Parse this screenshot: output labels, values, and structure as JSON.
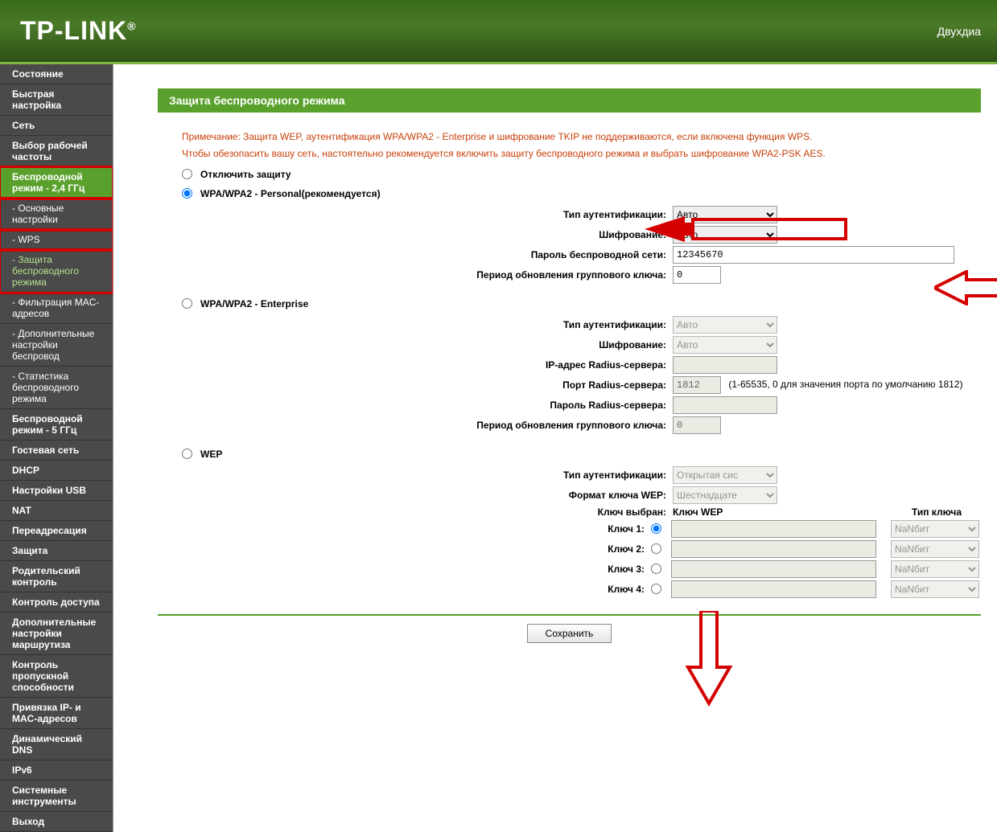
{
  "header": {
    "logo": "TP-LINK",
    "logo_reg": "®",
    "right": "Двухдиа"
  },
  "sidebar": {
    "items": [
      {
        "label": "Состояние",
        "sub": false
      },
      {
        "label": "Быстрая настройка",
        "sub": false
      },
      {
        "label": "Сеть",
        "sub": false
      },
      {
        "label": "Выбор рабочей частоты",
        "sub": false
      },
      {
        "label": "Беспроводной режим - 2,4 ГГц",
        "sub": false,
        "active": true,
        "hl": true
      },
      {
        "label": "- Основные настройки",
        "sub": true,
        "hl": true
      },
      {
        "label": "- WPS",
        "sub": true,
        "hl": true
      },
      {
        "label": "- Защита беспроводного режима",
        "sub": true,
        "current": true,
        "hl": true
      },
      {
        "label": "- Фильтрация MAC-адресов",
        "sub": true
      },
      {
        "label": "- Дополнительные настройки беспровод",
        "sub": true
      },
      {
        "label": "- Статистика беспроводного режима",
        "sub": true
      },
      {
        "label": "Беспроводной режим - 5 ГГц",
        "sub": false
      },
      {
        "label": "Гостевая сеть",
        "sub": false
      },
      {
        "label": "DHCP",
        "sub": false
      },
      {
        "label": "Настройки USB",
        "sub": false
      },
      {
        "label": "NAT",
        "sub": false
      },
      {
        "label": "Переадресация",
        "sub": false
      },
      {
        "label": "Защита",
        "sub": false
      },
      {
        "label": "Родительский контроль",
        "sub": false
      },
      {
        "label": "Контроль доступа",
        "sub": false
      },
      {
        "label": "Дополнительные настройки маршрутиза",
        "sub": false
      },
      {
        "label": "Контроль пропускной способности",
        "sub": false
      },
      {
        "label": "Привязка IP- и MAC-адресов",
        "sub": false
      },
      {
        "label": "Динамический DNS",
        "sub": false
      },
      {
        "label": "IPv6",
        "sub": false
      },
      {
        "label": "Системные инструменты",
        "sub": false
      },
      {
        "label": "Выход",
        "sub": false
      }
    ]
  },
  "page": {
    "title": "Защита беспроводного режима",
    "note1": "Примечание: Защита WEP, аутентификация WPA/WPA2 - Enterprise и шифрование TKIP не поддерживаются, если включена функция WPS.",
    "note2": "Чтобы обезопасить вашу сеть, настоятельно рекомендуется включить защиту беспроводного режима и выбрать шифрование WPA2-PSK AES."
  },
  "opt_disable": {
    "label": "Отключить защиту"
  },
  "personal": {
    "label": "WPA/WPA2 - Personal(рекомендуется)",
    "auth_label": "Тип аутентификации:",
    "auth_value": "Авто",
    "enc_label": "Шифрование:",
    "enc_value": "Авто",
    "pwd_label": "Пароль беспроводной сети:",
    "pwd_value": "12345670",
    "period_label": "Период обновления группового ключа:",
    "period_value": "0"
  },
  "enterprise": {
    "label": "WPA/WPA2 - Enterprise",
    "auth_label": "Тип аутентификации:",
    "auth_value": "Авто",
    "enc_label": "Шифрование:",
    "enc_value": "Авто",
    "radius_ip_label": "IP-адрес Radius-сервера:",
    "radius_ip_value": "",
    "radius_port_label": "Порт Radius-сервера:",
    "radius_port_value": "1812",
    "radius_port_hint": "(1-65535, 0 для значения порта по умолчанию 1812)",
    "radius_pwd_label": "Пароль Radius-сервера:",
    "radius_pwd_value": "",
    "period_label": "Период обновления группового ключа:",
    "period_value": "0"
  },
  "wep": {
    "label": "WEP",
    "auth_label": "Тип аутентификации:",
    "auth_value": "Открытая сис",
    "fmt_label": "Формат ключа WEP:",
    "fmt_value": "Шестнадцате",
    "sel_label": "Ключ выбран:",
    "col_key": "Ключ WEP",
    "col_type": "Тип ключа",
    "keys": [
      {
        "label": "Ключ 1:",
        "type": "NaNбит"
      },
      {
        "label": "Ключ 2:",
        "type": "NaNбит"
      },
      {
        "label": "Ключ 3:",
        "type": "NaNбит"
      },
      {
        "label": "Ключ 4:",
        "type": "NaNбит"
      }
    ]
  },
  "save": "Сохранить"
}
